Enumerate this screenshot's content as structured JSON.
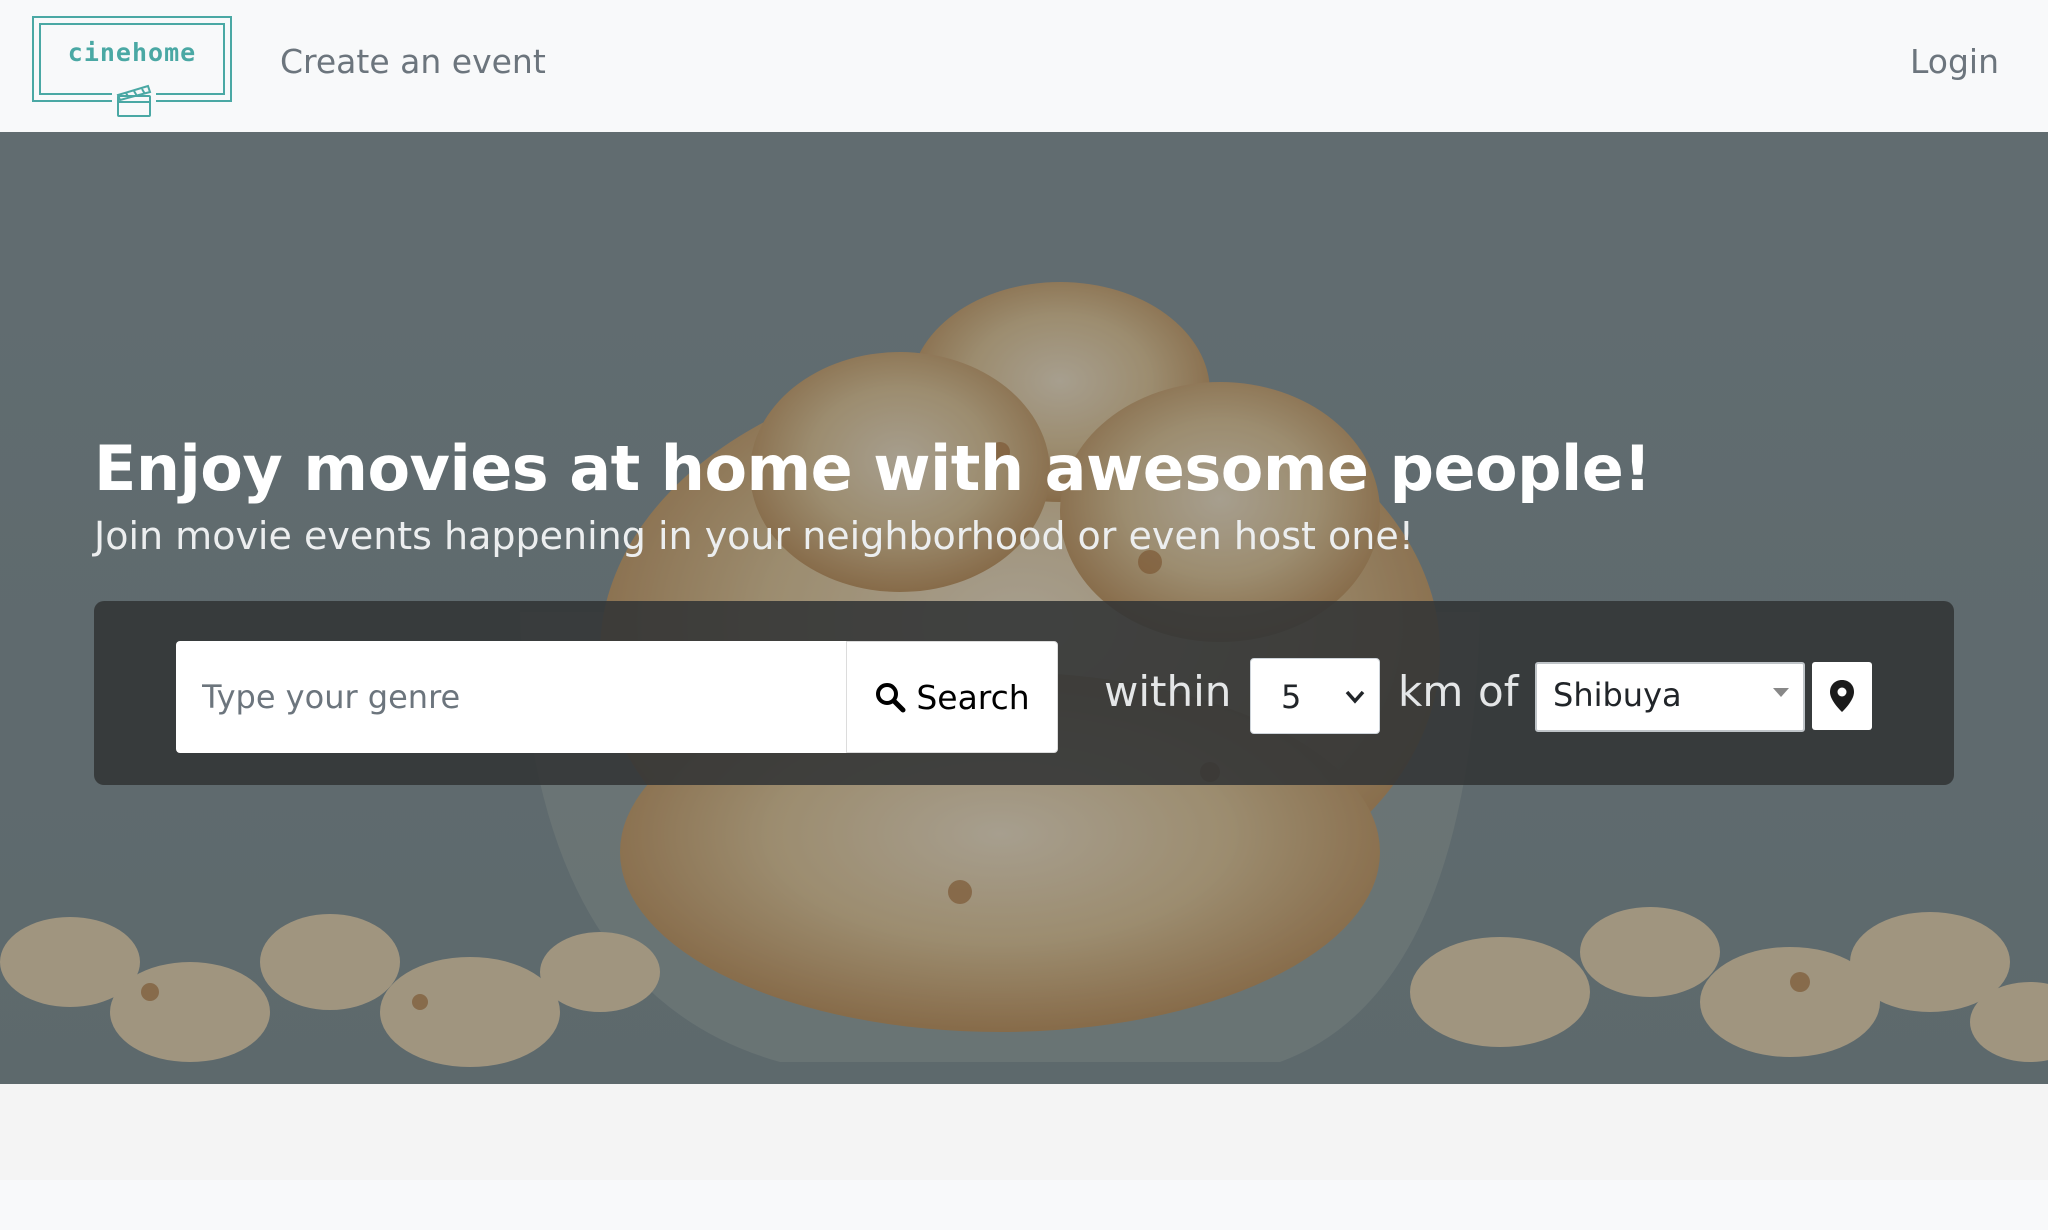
{
  "navbar": {
    "logo_text": "cinehome",
    "create_event_label": "Create an event",
    "login_label": "Login"
  },
  "hero": {
    "title": "Enjoy movies at home with awesome people!",
    "subtitle": "Join movie events happening in your neighborhood or even host one!"
  },
  "search": {
    "genre_placeholder": "Type your genre",
    "button_label": "Search",
    "within_label": "within",
    "radius_value": "5",
    "km_label": "km",
    "of_label": "of",
    "location_value": "Shibuya"
  },
  "icons": {
    "search": "search-icon",
    "location": "map-marker-icon",
    "logo": "clapperboard-icon"
  },
  "colors": {
    "brand": "#4aa8a4",
    "nav_bg": "#f8f9fa",
    "panel_bg": "#323436"
  }
}
